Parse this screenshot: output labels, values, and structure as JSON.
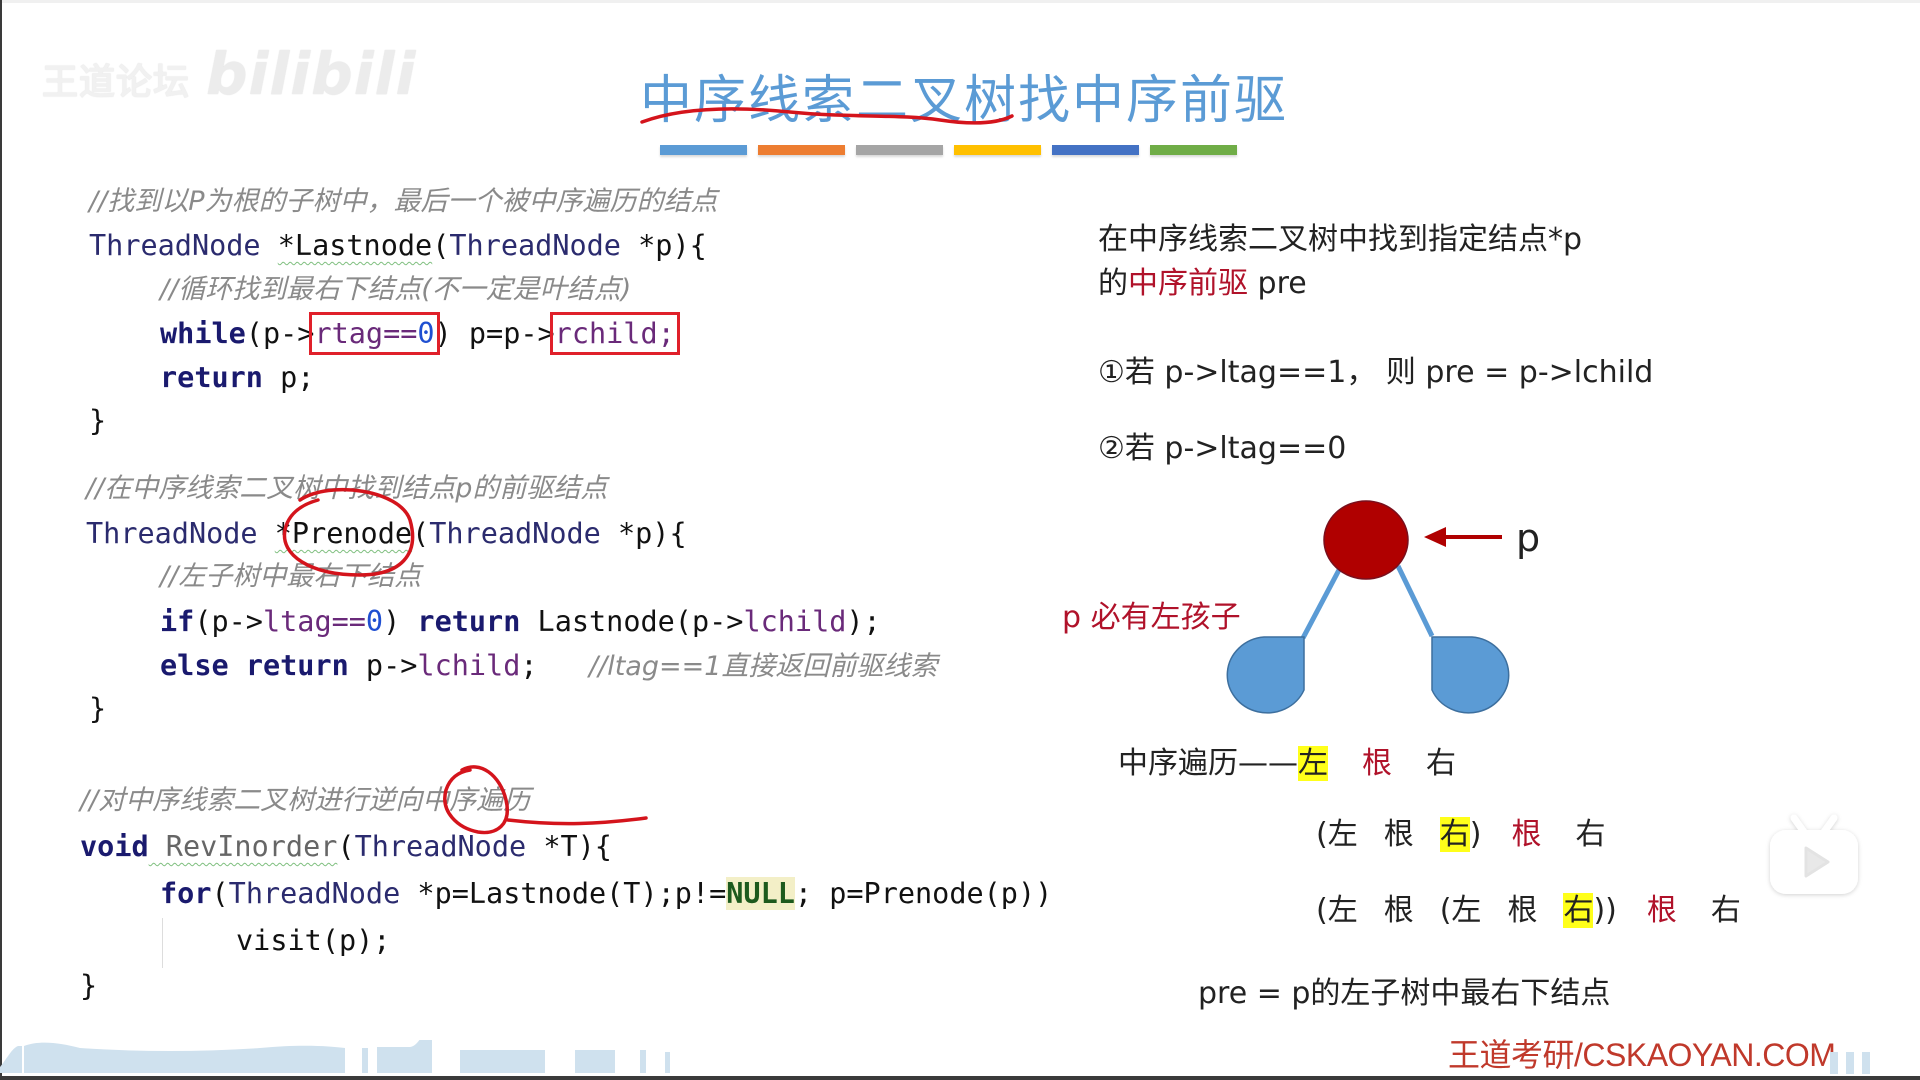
{
  "watermark": {
    "text": "王道论坛",
    "brand": "bilibili"
  },
  "slide": {
    "title": "中序线索二叉树找中序前驱",
    "title_color": "#5b9bd5",
    "accent_bars": [
      "#5b9bd5",
      "#ed7d31",
      "#a5a5a5",
      "#ffc000",
      "#4472c4",
      "#70ad47"
    ]
  },
  "code": {
    "block1": {
      "comment": "//找到以P为根的子树中，最后一个被中序遍历的结点",
      "sig_type": "ThreadNode",
      "sig_name": "*Lastnode",
      "sig_params_type": "ThreadNode",
      "sig_params_rest": " *p){",
      "inner_comment": "//循环找到最右下结点(不一定是叶结点)",
      "while_kw": "while",
      "while_pre": "(p->",
      "while_cond_field": "rtag==",
      "while_cond_num": "0",
      "while_mid": ") p=p->",
      "while_field": "rchild;",
      "return_kw": "return",
      "return_rest": " p;",
      "close": "}"
    },
    "block2": {
      "comment": "//在中序线索二叉树中找到结点p的前驱结点",
      "sig_type": "ThreadNode",
      "sig_name": "*Prenode",
      "sig_params_type": "ThreadNode",
      "sig_params_rest": " *p){",
      "inner_comment": "//左子树中最右下结点",
      "if_kw": "if",
      "if_pre": "(p->",
      "if_field": "ltag==",
      "if_num": "0",
      "if_mid": ") ",
      "if_return_kw": "return",
      "if_call": " Lastnode(p->",
      "if_call_field": "lchild",
      "if_end": ");",
      "else_kw": "else",
      "else_return_kw": "return",
      "else_rest": " p->",
      "else_field": "lchild",
      "else_end": ";",
      "else_comment": "//ltag==1直接返回前驱线索",
      "close": "}"
    },
    "block3": {
      "comment": "//对中序线索二叉树进行逆向中序遍历",
      "void_kw": "void",
      "fn_name": " RevInorder",
      "paren": "(",
      "param_type": "ThreadNode",
      "param_rest": " *T){",
      "for_kw": "for",
      "for_paren": "(",
      "for_type": "ThreadNode",
      "for_init": " *p=Lastnode(T);p!=",
      "for_null": "NULL",
      "for_rest": "; p=Prenode(p))",
      "body": "visit(p);",
      "close": "}"
    }
  },
  "explanation": {
    "line1": "在中序线索二叉树中找到指定结点*p",
    "line2_prefix": "的",
    "line2_red": "中序前驱",
    "line2_suffix": " pre",
    "case1": "①若 p->ltag==1，  则 pre = p->lchild",
    "case2": "②若 p->ltag==0",
    "diagram": {
      "pointer_label": "p",
      "annotation": "p 必有左孩子",
      "root_color": "#b00000",
      "child_color": "#5b9bd5"
    },
    "traversal": {
      "label": "中序遍历——",
      "row1": [
        "左",
        "根",
        "右"
      ],
      "row2": [
        "(左",
        "根",
        "右",
        ")",
        "根",
        "右"
      ],
      "row3": [
        "(左",
        "根",
        "(左",
        "根",
        "右",
        "))",
        "根",
        "右"
      ]
    },
    "conclusion": "pre = p的左子树中最右下结点"
  },
  "footer": {
    "logo": "王道考研/CSKAOYAN.COM"
  }
}
